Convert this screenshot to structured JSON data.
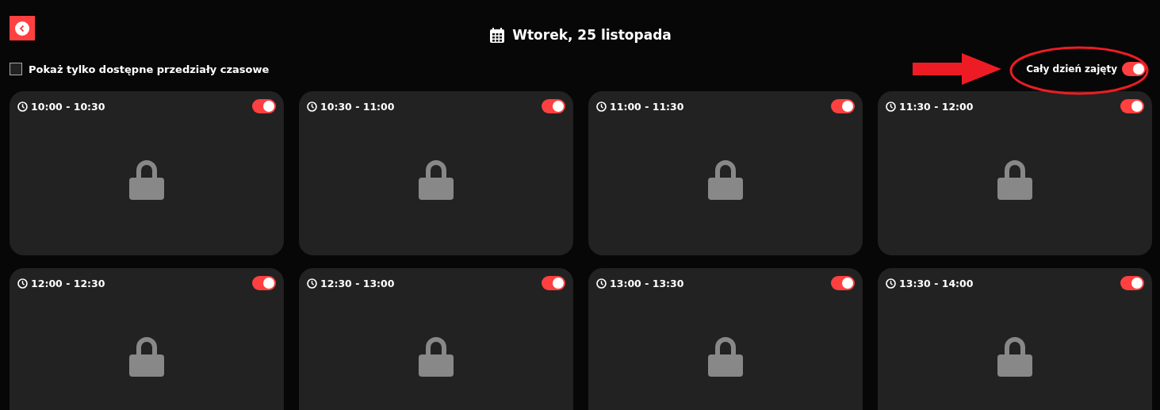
{
  "header": {
    "title": "Wtorek, 25 listopada"
  },
  "filter": {
    "label": "Pokaż tylko dostępne przedziały czasowe",
    "checked": false
  },
  "full_day": {
    "label": "Cały dzień zajęty",
    "on": true
  },
  "slots": [
    {
      "time": "10:00 - 10:30",
      "on": true
    },
    {
      "time": "10:30 - 11:00",
      "on": true
    },
    {
      "time": "11:00 - 11:30",
      "on": true
    },
    {
      "time": "11:30 - 12:00",
      "on": true
    },
    {
      "time": "12:00 - 12:30",
      "on": true
    },
    {
      "time": "12:30 - 13:00",
      "on": true
    },
    {
      "time": "13:00 - 13:30",
      "on": true
    },
    {
      "time": "13:30 - 14:00",
      "on": true
    }
  ]
}
